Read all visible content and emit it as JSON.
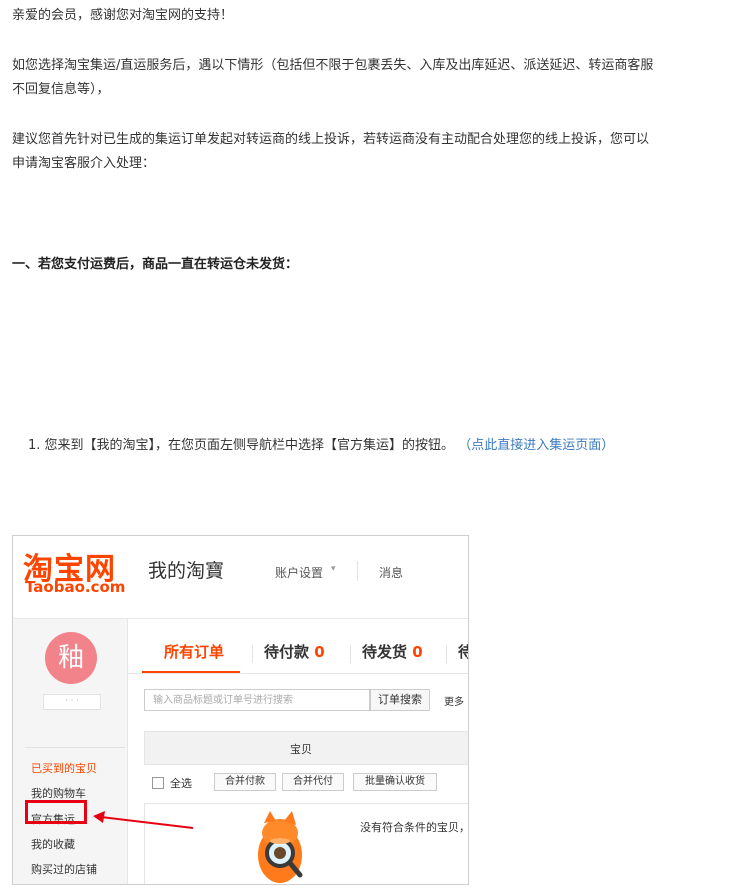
{
  "article": {
    "greeting": "亲爱的会员，感谢您对淘宝网的支持！",
    "intro_line1": "如您选择淘宝集运/直运服务后，遇以下情形（包括但不限于包裹丢失、入库及出库延迟、派送延迟、转运商客服",
    "intro_line2": "不回复信息等），",
    "advice_line1": "建议您首先针对已生成的集运订单发起对转运商的线上投诉，若转运商没有主动配合处理您的线上投诉，您可以",
    "advice_line2": "申请淘宝客服介入处理：",
    "section1_title": "一、若您支付运费后，商品一直在转运仓未发货：",
    "step1_num": "1.",
    "step1_text": "您来到【我的淘宝】，在您页面左侧导航栏中选择【官方集运】的按钮。",
    "step1_link": "（点此直接进入集运页面）"
  },
  "screenshot": {
    "logo_cn": "淘宝网",
    "logo_en": "Taobao.com",
    "page_title": "我的淘寶",
    "account_settings": "账户设置",
    "account_caret": "▾",
    "messages": "消息",
    "avatar_char": "釉",
    "username_masked": "· · ·",
    "sidebar": {
      "bought": "已买到的宝贝",
      "cart": "我的购物车",
      "official_shipping": "官方集运",
      "favorites": "我的收藏",
      "stores": "购买过的店铺"
    },
    "tabs": {
      "all_orders": "所有订单",
      "to_pay": "待付款",
      "to_pay_count": "0",
      "to_ship": "待发货",
      "to_ship_count": "0",
      "next_partial": "待"
    },
    "search_placeholder": "输入商品标题或订单号进行搜索",
    "search_button": "订单搜索",
    "more_partial": "更多",
    "table_header": "宝贝",
    "select_all": "全选",
    "merge_pay": "合并付款",
    "merge_proxy_pay": "合并代付",
    "batch_confirm": "批量确认收货",
    "empty_message": "没有符合条件的宝贝，",
    "accent_color": "#ff4400",
    "highlight_color": "#e60012"
  }
}
